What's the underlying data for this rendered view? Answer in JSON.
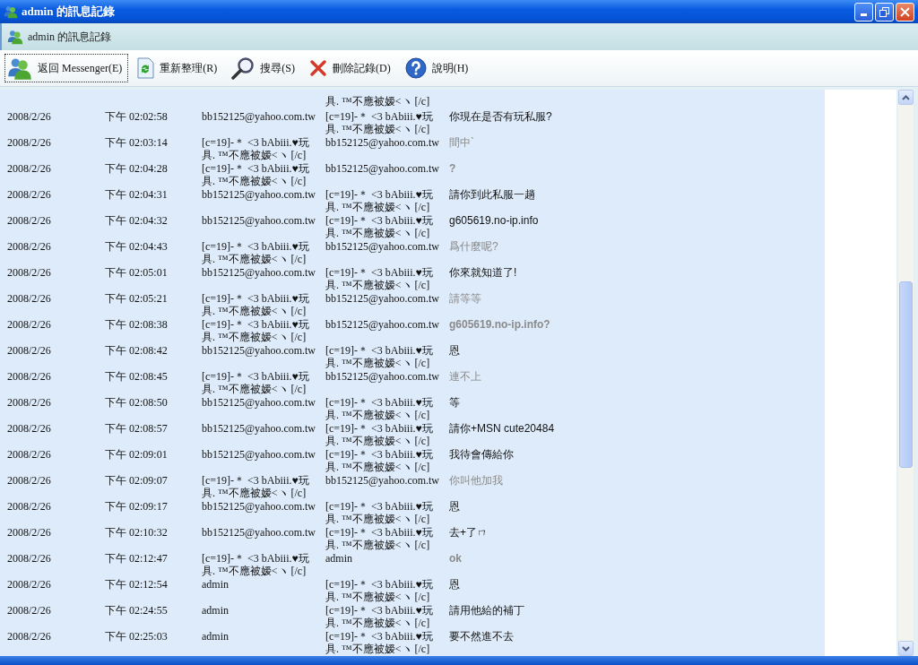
{
  "window": {
    "title": "admin 的訊息記錄"
  },
  "header": {
    "title": "admin 的訊息記錄"
  },
  "toolbar": [
    {
      "label": "返回 Messenger(E)",
      "focused": true
    },
    {
      "label": "重新整理(R)",
      "focused": false
    },
    {
      "label": "搜尋(S)",
      "focused": false
    },
    {
      "label": "刪除記錄(D)",
      "focused": false
    },
    {
      "label": "說明(H)",
      "focused": false
    }
  ],
  "partial_row": {
    "to": "具. ™不應被嫒<ヽ [/c]"
  },
  "rows": [
    {
      "date": "2008/2/26",
      "time": "下午 02:02:58",
      "from": "bb152125@yahoo.com.tw",
      "to": "[c=19]-＊ <3 bAbiii.♥玩具. ™不應被嫒<ヽ [/c]",
      "message": "你現在是否有玩私服?",
      "kind": "normal"
    },
    {
      "date": "2008/2/26",
      "time": "下午 02:03:14",
      "from": "[c=19]-＊ <3 bAbiii.♥玩具. ™不應被嫒<ヽ [/c]",
      "to": "bb152125@yahoo.com.tw",
      "message": "間中`",
      "kind": "gray"
    },
    {
      "date": "2008/2/26",
      "time": "下午 02:04:28",
      "from": "[c=19]-＊ <3 bAbiii.♥玩具. ™不應被嫒<ヽ [/c]",
      "to": "bb152125@yahoo.com.tw",
      "message": "?",
      "kind": "gray-bold"
    },
    {
      "date": "2008/2/26",
      "time": "下午 02:04:31",
      "from": "bb152125@yahoo.com.tw",
      "to": "[c=19]-＊ <3 bAbiii.♥玩具. ™不應被嫒<ヽ [/c]",
      "message": "請你到此私服一趟",
      "kind": "normal"
    },
    {
      "date": "2008/2/26",
      "time": "下午 02:04:32",
      "from": "bb152125@yahoo.com.tw",
      "to": "[c=19]-＊ <3 bAbiii.♥玩具. ™不應被嫒<ヽ [/c]",
      "message": "g605619.no-ip.info",
      "kind": "normal"
    },
    {
      "date": "2008/2/26",
      "time": "下午 02:04:43",
      "from": "[c=19]-＊ <3 bAbiii.♥玩具. ™不應被嫒<ヽ [/c]",
      "to": "bb152125@yahoo.com.tw",
      "message": "爲什麼呢?",
      "kind": "gray"
    },
    {
      "date": "2008/2/26",
      "time": "下午 02:05:01",
      "from": "bb152125@yahoo.com.tw",
      "to": "[c=19]-＊ <3 bAbiii.♥玩具. ™不應被嫒<ヽ [/c]",
      "message": "你來就知道了!",
      "kind": "normal"
    },
    {
      "date": "2008/2/26",
      "time": "下午 02:05:21",
      "from": "[c=19]-＊ <3 bAbiii.♥玩具. ™不應被嫒<ヽ [/c]",
      "to": "bb152125@yahoo.com.tw",
      "message": "請等等",
      "kind": "gray"
    },
    {
      "date": "2008/2/26",
      "time": "下午 02:08:38",
      "from": "[c=19]-＊ <3 bAbiii.♥玩具. ™不應被嫒<ヽ [/c]",
      "to": "bb152125@yahoo.com.tw",
      "message": "g605619.no-ip.info?",
      "kind": "gray-bold"
    },
    {
      "date": "2008/2/26",
      "time": "下午 02:08:42",
      "from": "bb152125@yahoo.com.tw",
      "to": "[c=19]-＊ <3 bAbiii.♥玩具. ™不應被嫒<ヽ [/c]",
      "message": "恩",
      "kind": "normal"
    },
    {
      "date": "2008/2/26",
      "time": "下午 02:08:45",
      "from": "[c=19]-＊ <3 bAbiii.♥玩具. ™不應被嫒<ヽ [/c]",
      "to": "bb152125@yahoo.com.tw",
      "message": "連不上",
      "kind": "gray"
    },
    {
      "date": "2008/2/26",
      "time": "下午 02:08:50",
      "from": "bb152125@yahoo.com.tw",
      "to": "[c=19]-＊ <3 bAbiii.♥玩具. ™不應被嫒<ヽ [/c]",
      "message": "等",
      "kind": "normal"
    },
    {
      "date": "2008/2/26",
      "time": "下午 02:08:57",
      "from": "bb152125@yahoo.com.tw",
      "to": "[c=19]-＊ <3 bAbiii.♥玩具. ™不應被嫒<ヽ [/c]",
      "message": "請你+MSN cute20484",
      "kind": "normal"
    },
    {
      "date": "2008/2/26",
      "time": "下午 02:09:01",
      "from": "bb152125@yahoo.com.tw",
      "to": "[c=19]-＊ <3 bAbiii.♥玩具. ™不應被嫒<ヽ [/c]",
      "message": "我待會傳給你",
      "kind": "normal"
    },
    {
      "date": "2008/2/26",
      "time": "下午 02:09:07",
      "from": "[c=19]-＊ <3 bAbiii.♥玩具. ™不應被嫒<ヽ [/c]",
      "to": "bb152125@yahoo.com.tw",
      "message": "你叫他加我",
      "kind": "gray"
    },
    {
      "date": "2008/2/26",
      "time": "下午 02:09:17",
      "from": "bb152125@yahoo.com.tw",
      "to": "[c=19]-＊ <3 bAbiii.♥玩具. ™不應被嫒<ヽ [/c]",
      "message": "恩",
      "kind": "normal"
    },
    {
      "date": "2008/2/26",
      "time": "下午 02:10:32",
      "from": "bb152125@yahoo.com.tw",
      "to": "[c=19]-＊ <3 bAbiii.♥玩具. ™不應被嫒<ヽ [/c]",
      "message": "去+了ㄇ",
      "kind": "normal"
    },
    {
      "date": "2008/2/26",
      "time": "下午 02:12:47",
      "from": "[c=19]-＊ <3 bAbiii.♥玩具. ™不應被嫒<ヽ [/c]",
      "to": "admin",
      "message": "ok",
      "kind": "gray-bold"
    },
    {
      "date": "2008/2/26",
      "time": "下午 02:12:54",
      "from": "admin",
      "to": "[c=19]-＊ <3 bAbiii.♥玩具. ™不應被嫒<ヽ [/c]",
      "message": "恩",
      "kind": "normal"
    },
    {
      "date": "2008/2/26",
      "time": "下午 02:24:55",
      "from": "admin",
      "to": "[c=19]-＊ <3 bAbiii.♥玩具. ™不應被嫒<ヽ [/c]",
      "message": "請用他給的補丁",
      "kind": "normal"
    },
    {
      "date": "2008/2/26",
      "time": "下午 02:25:03",
      "from": "admin",
      "to": "[c=19]-＊ <3 bAbiii.♥玩具. ™不應被嫒<ヽ [/c]",
      "message": "要不然進不去",
      "kind": "normal"
    }
  ]
}
